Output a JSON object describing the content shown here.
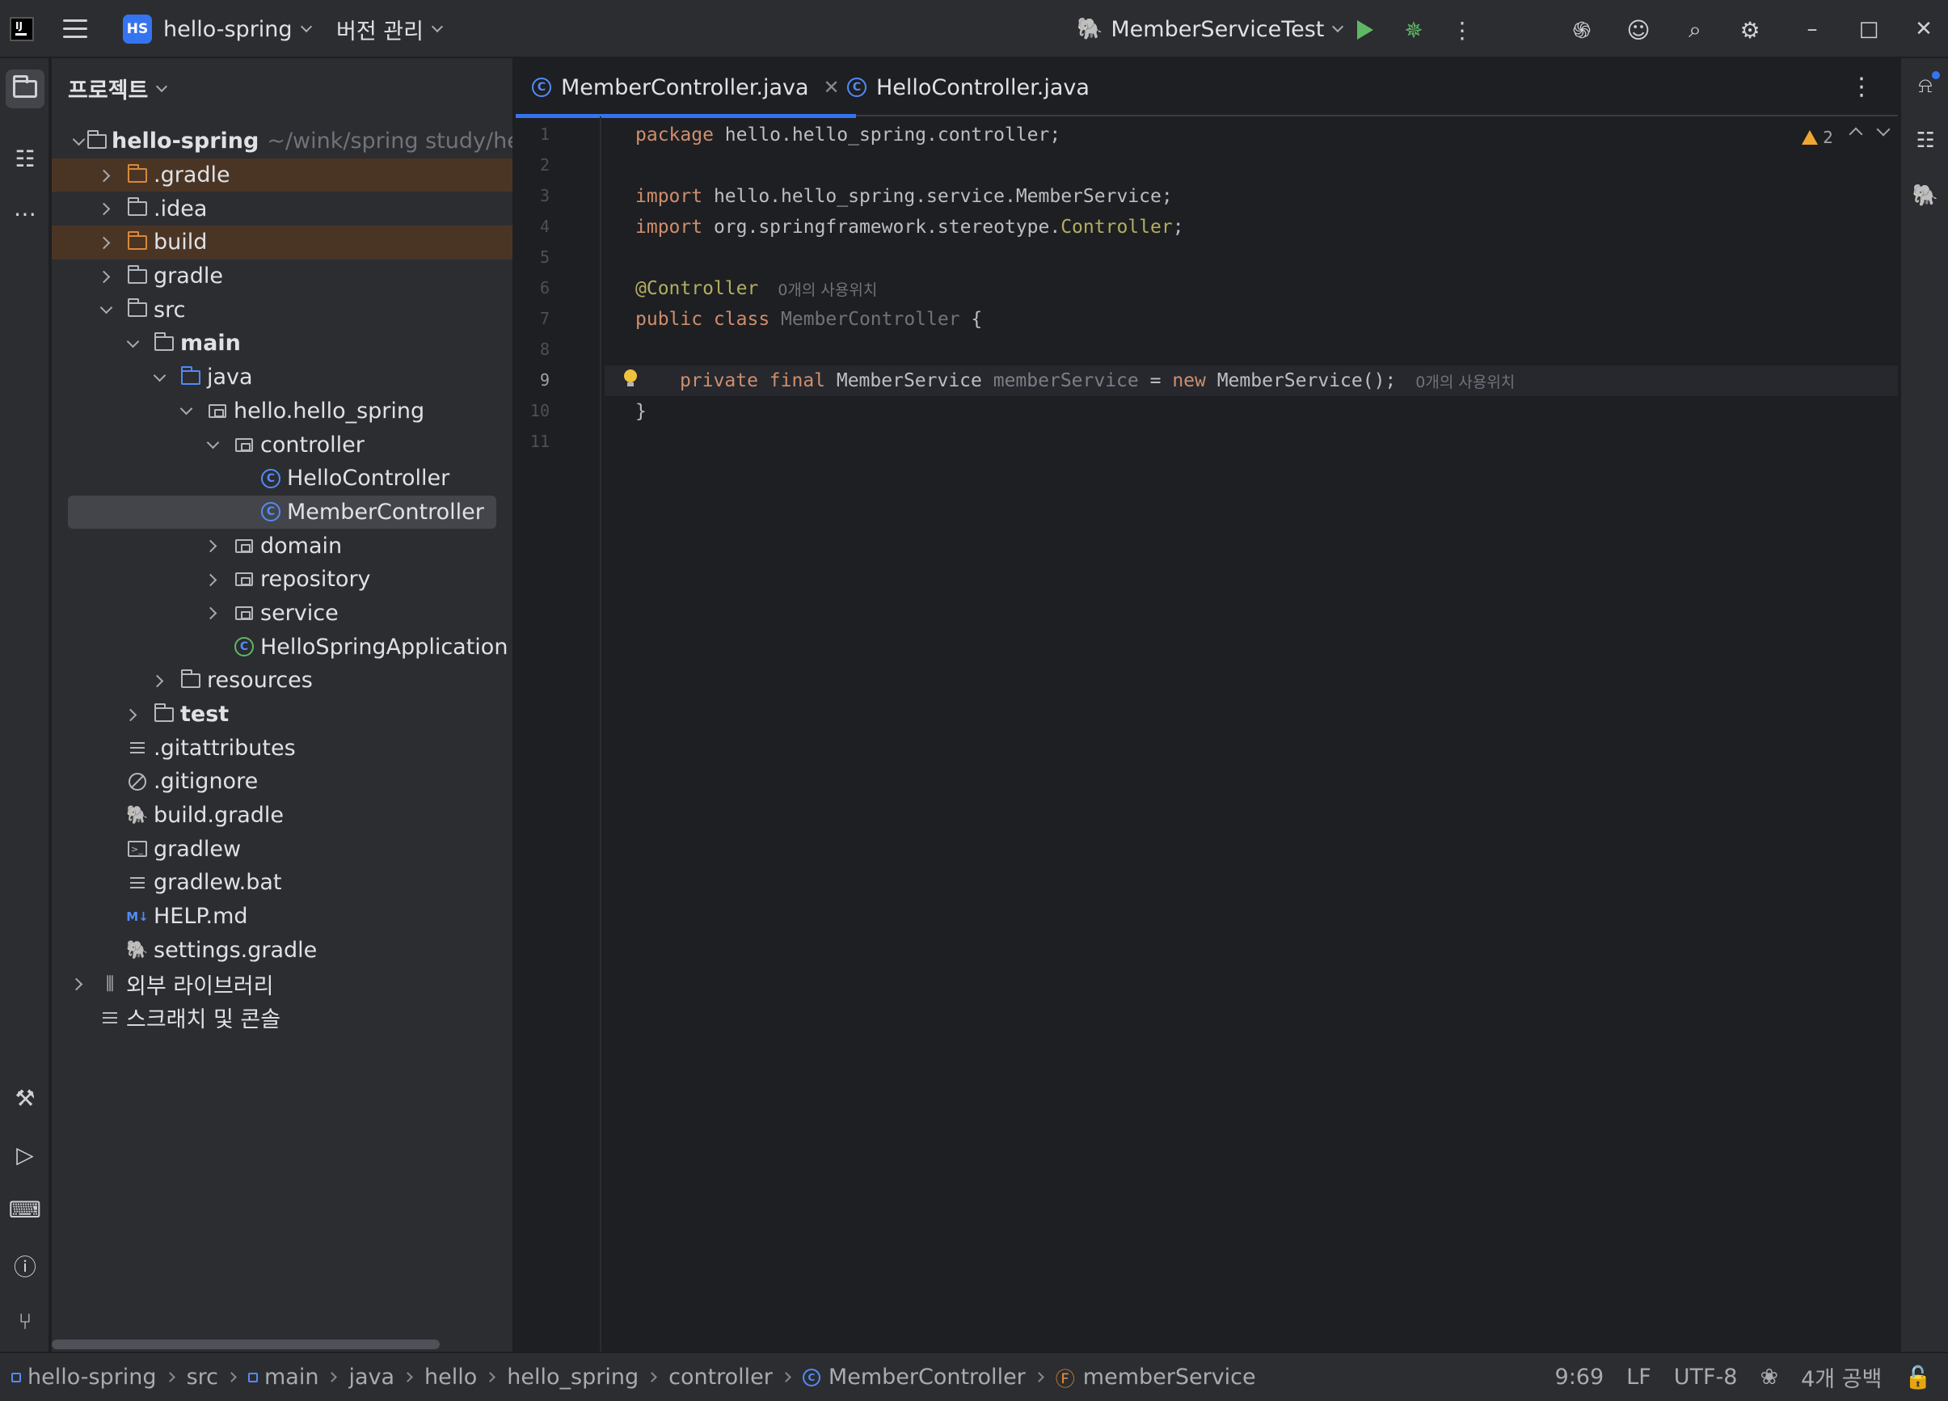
{
  "titlebar": {
    "project_badge": "HS",
    "project_name": "hello-spring",
    "vcs_menu": "버전 관리",
    "run_config": "MemberServiceTest"
  },
  "project_panel": {
    "title": "프로젝트",
    "root_name": "hello-spring",
    "root_path": "~/wink/spring study/hello-",
    "items": [
      {
        "label": ".gradle"
      },
      {
        "label": ".idea"
      },
      {
        "label": "build"
      },
      {
        "label": "gradle"
      },
      {
        "label": "src"
      },
      {
        "label": "main"
      },
      {
        "label": "java"
      },
      {
        "label": "hello.hello_spring"
      },
      {
        "label": "controller"
      },
      {
        "label": "HelloController"
      },
      {
        "label": "MemberController"
      },
      {
        "label": "domain"
      },
      {
        "label": "repository"
      },
      {
        "label": "service"
      },
      {
        "label": "HelloSpringApplication"
      },
      {
        "label": "resources"
      },
      {
        "label": "test"
      },
      {
        "label": ".gitattributes"
      },
      {
        "label": ".gitignore"
      },
      {
        "label": "build.gradle"
      },
      {
        "label": "gradlew"
      },
      {
        "label": "gradlew.bat"
      },
      {
        "label": "HELP.md"
      },
      {
        "label": "settings.gradle"
      },
      {
        "label": "외부 라이브러리"
      },
      {
        "label": "스크래치 및 콘솔"
      }
    ]
  },
  "editor": {
    "tabs": [
      {
        "label": "MemberController.java"
      },
      {
        "label": "HelloController.java"
      }
    ],
    "line_numbers": [
      "1",
      "2",
      "3",
      "4",
      "5",
      "6",
      "7",
      "8",
      "9",
      "10",
      "11"
    ],
    "code": {
      "l1_kw": "package",
      "l1_rest": " hello.hello_spring.controller;",
      "l3_kw": "import",
      "l3_rest": " hello.hello_spring.service.MemberService;",
      "l4_kw": "import",
      "l4_rest": " org.springframework.stereotype.",
      "l4_cls": "Controller",
      "l4_end": ";",
      "l6_ann": "@Controller",
      "l6_hint": "0개의 사용위치",
      "l7_kw": "public class",
      "l7_cls": " MemberController",
      "l7_end": " {",
      "l9_kw": "private final",
      "l9_type": " MemberService",
      "l9_field": " memberService",
      "l9_eq": " = ",
      "l9_new": "new",
      "l9_rest": " MemberService();",
      "l9_hint": "0개의 사용위치",
      "l10": "}"
    },
    "warning_count": "2"
  },
  "statusbar": {
    "crumbs": [
      "hello-spring",
      "src",
      "main",
      "java",
      "hello",
      "hello_spring",
      "controller",
      "MemberController",
      "memberService"
    ],
    "cursor": "9:69",
    "line_sep": "LF",
    "encoding": "UTF-8",
    "indent": "4개 공백"
  }
}
